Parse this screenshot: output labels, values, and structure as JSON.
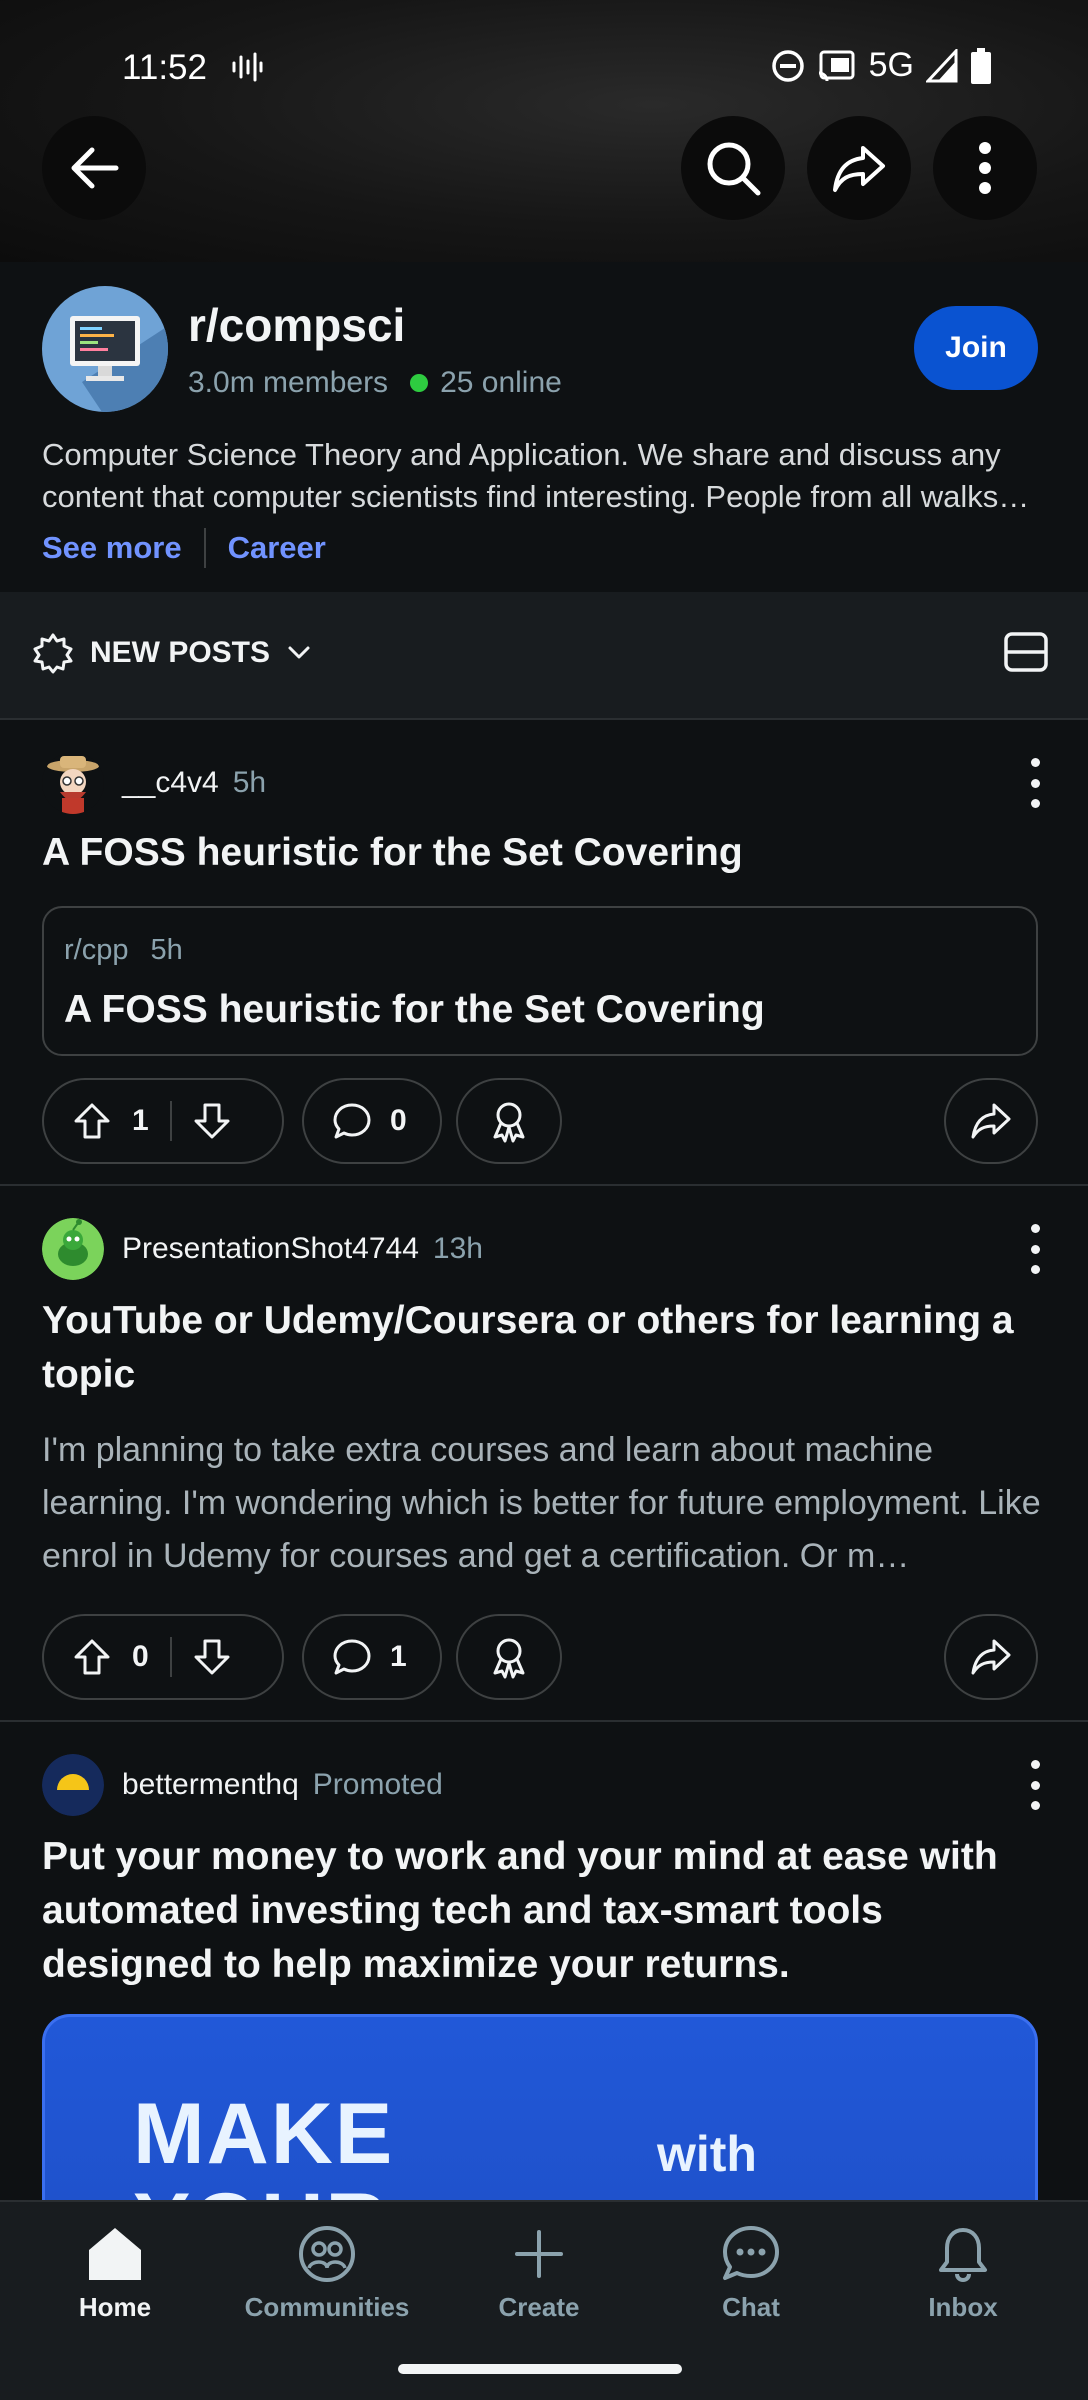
{
  "status_bar": {
    "time": "11:52",
    "network": "5G"
  },
  "header": {
    "back_icon": "arrow-left-icon",
    "search_icon": "search-icon",
    "share_icon": "share-icon",
    "more_icon": "more-vertical-icon"
  },
  "community": {
    "name": "r/compsci",
    "members": "3.0m members",
    "online": "25 online",
    "join_label": "Join",
    "description": "Computer Science Theory and Application. We share and discuss any content that computer scientists find interesting. People from all walks…",
    "see_more": "See more",
    "flair": "Career"
  },
  "sort": {
    "label": "NEW POSTS"
  },
  "posts": [
    {
      "user": "__c4v4",
      "time": "5h",
      "title": "A FOSS heuristic for the Set Covering",
      "crosspost": {
        "sub": "r/cpp",
        "time": "5h",
        "title": "A FOSS heuristic for the Set Covering"
      },
      "votes": "1",
      "comments": "0"
    },
    {
      "user": "PresentationShot4744",
      "time": "13h",
      "title": "YouTube or Udemy/Coursera or others for learning a topic",
      "body": "I'm planning to take extra courses and learn about machine learning. I'm wondering which is better for future employment. Like enrol in Udemy for courses and get a certification. Or m…",
      "votes": "0",
      "comments": "1"
    },
    {
      "user": "bettermenthq",
      "tag": "Promoted",
      "title": "Put your money to work and your mind at ease with automated investing tech and tax-smart tools designed to help maximize your returns.",
      "ad_text_1": "MAKE",
      "ad_text_2": "YOUR",
      "ad_text_3": "with"
    }
  ],
  "nav": {
    "home": "Home",
    "communities": "Communities",
    "create": "Create",
    "chat": "Chat",
    "inbox": "Inbox"
  },
  "colors": {
    "background": "#0e1113",
    "accent_join": "#0a53d1",
    "link": "#7193ff",
    "online": "#2ecc40"
  }
}
